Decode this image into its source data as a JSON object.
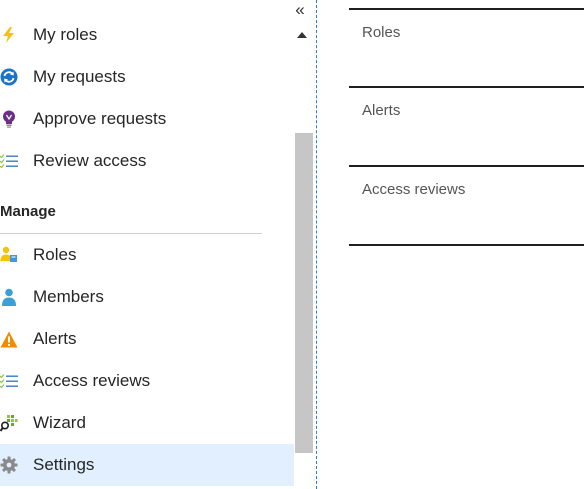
{
  "nav": {
    "items_top": [
      {
        "label": "My roles",
        "icon": "lightning-icon"
      },
      {
        "label": "My requests",
        "icon": "sync-icon"
      },
      {
        "label": "Approve requests",
        "icon": "lightbulb-icon"
      },
      {
        "label": "Review access",
        "icon": "checklist-icon"
      }
    ],
    "section_title": "Manage",
    "items_manage": [
      {
        "label": "Roles",
        "icon": "roles-icon"
      },
      {
        "label": "Members",
        "icon": "member-icon"
      },
      {
        "label": "Alerts",
        "icon": "warning-icon"
      },
      {
        "label": "Access reviews",
        "icon": "checklist-icon"
      },
      {
        "label": "Wizard",
        "icon": "wizard-icon"
      },
      {
        "label": "Settings",
        "icon": "gear-icon",
        "selected": true
      }
    ],
    "collapse_glyph": "«"
  },
  "panel": {
    "cards": [
      {
        "title": "Roles"
      },
      {
        "title": "Alerts"
      },
      {
        "title": "Access reviews"
      }
    ]
  },
  "colors": {
    "selected_bg": "#e1efff",
    "accent_blue": "#2f7fc5",
    "lightning": "#f5c400",
    "sync": "#1a73c9",
    "bulb": "#6b2f8a",
    "warning": "#f08c00",
    "member": "#3aa0d8"
  }
}
